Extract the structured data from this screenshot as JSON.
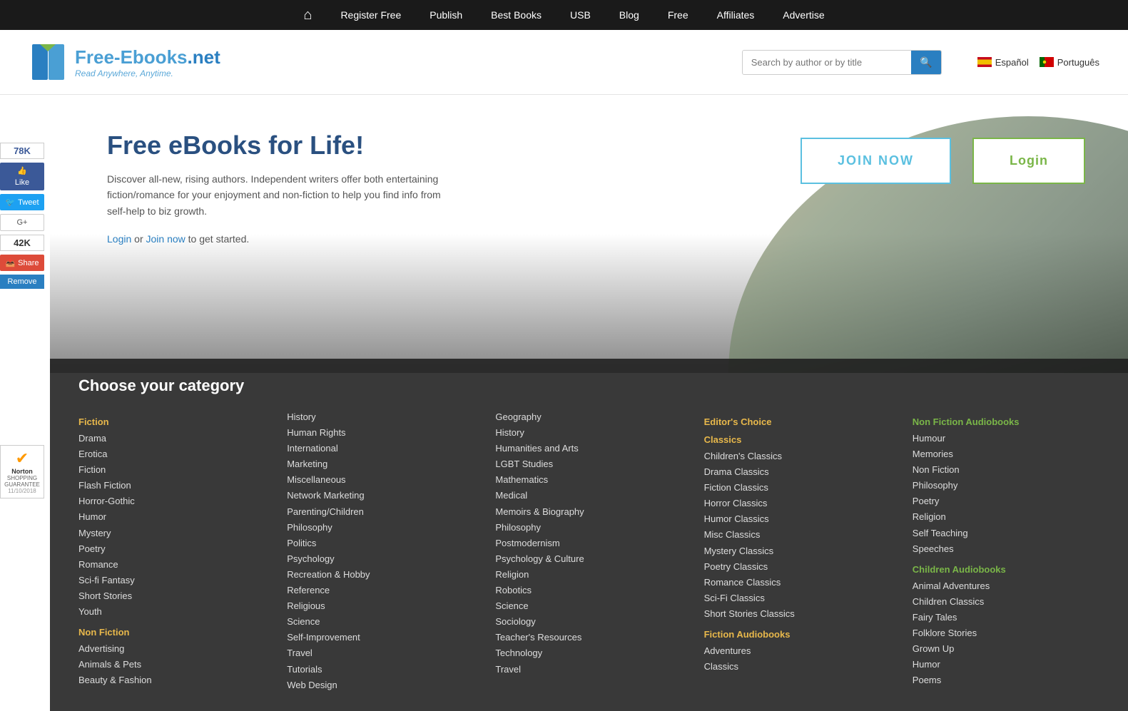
{
  "topnav": {
    "items": [
      {
        "label": "Register Free",
        "name": "register-free"
      },
      {
        "label": "Publish",
        "name": "publish"
      },
      {
        "label": "Best Books",
        "name": "best-books"
      },
      {
        "label": "USB",
        "name": "usb"
      },
      {
        "label": "Blog",
        "name": "blog"
      },
      {
        "label": "Free",
        "name": "free"
      },
      {
        "label": "Affiliates",
        "name": "affiliates"
      },
      {
        "label": "Advertise",
        "name": "advertise"
      }
    ]
  },
  "header": {
    "logo_name": "Free-Ebooks.net",
    "logo_tagline": "Read Anywhere, Anytime.",
    "search_placeholder": "Search by author or by title",
    "lang1": "Español",
    "lang2": "Português"
  },
  "social": {
    "fb_count": "78K",
    "fb_label": "Like",
    "tweet_label": "Tweet",
    "gplus_label": "G+",
    "share_count": "42K",
    "share_label": "Share",
    "remove_label": "Remove"
  },
  "hero": {
    "title": "Free eBooks for Life!",
    "description": "Discover all-new, rising authors. Independent writers offer both entertaining fiction/romance for your enjoyment and non-fiction to help you find info from self-help to biz growth.",
    "login_text": "Login",
    "or_text": "or",
    "join_text": "Join now",
    "get_started": "to get started.",
    "btn_join": "JOIN NOW",
    "btn_login": "Login"
  },
  "categories": {
    "title": "Choose your category",
    "cols": [
      {
        "sections": [
          {
            "heading": "Fiction",
            "heading_style": "gold",
            "items": [
              "Drama",
              "Erotica",
              "Fiction",
              "Flash Fiction",
              "Horror-Gothic",
              "Humor",
              "Mystery",
              "Poetry",
              "Romance",
              "Sci-fi Fantasy",
              "Short Stories",
              "Youth"
            ]
          },
          {
            "heading": "Non Fiction",
            "heading_style": "gold",
            "items": [
              "Advertising",
              "Animals & Pets",
              "Beauty & Fashion"
            ]
          }
        ]
      },
      {
        "sections": [
          {
            "heading": "",
            "heading_style": "",
            "items": [
              "History",
              "Human Rights",
              "International",
              "Marketing",
              "Miscellaneous",
              "Network Marketing",
              "Parenting/Children",
              "Philosophy",
              "Politics",
              "Psychology",
              "Recreation & Hobby",
              "Reference",
              "Religious",
              "Science",
              "Self-Improvement",
              "Travel",
              "Tutorials",
              "Web Design"
            ]
          }
        ]
      },
      {
        "sections": [
          {
            "heading": "",
            "heading_style": "",
            "items": [
              "Geography",
              "History",
              "Humanities and Arts",
              "LGBT Studies",
              "Mathematics",
              "Medical",
              "Memoirs & Biography",
              "Philosophy",
              "Postmodernism",
              "Psychology & Culture",
              "Religion",
              "Robotics",
              "Science",
              "Sociology",
              "Teacher's Resources",
              "Technology",
              "Travel"
            ]
          }
        ]
      },
      {
        "sections": [
          {
            "heading": "Editor's Choice",
            "heading_style": "gold",
            "items": []
          },
          {
            "heading": "Classics",
            "heading_style": "gold",
            "items": [
              "Children's Classics",
              "Drama Classics",
              "Fiction Classics",
              "Horror Classics",
              "Humor Classics",
              "Misc Classics",
              "Mystery Classics",
              "Poetry Classics",
              "Romance Classics",
              "Sci-Fi Classics",
              "Short Stories Classics"
            ]
          },
          {
            "heading": "Fiction Audiobooks",
            "heading_style": "gold",
            "items": [
              "Adventures",
              "Classics"
            ]
          }
        ]
      },
      {
        "sections": [
          {
            "heading": "Non Fiction Audiobooks",
            "heading_style": "green",
            "items": [
              "Humour",
              "Memories",
              "Non Fiction",
              "Philosophy",
              "Poetry",
              "Religion",
              "Self Teaching",
              "Speeches"
            ]
          },
          {
            "heading": "Children Audiobooks",
            "heading_style": "green",
            "items": [
              "Animal Adventures",
              "Children Classics",
              "Fairy Tales",
              "Folklore Stories",
              "Grown Up",
              "Humor",
              "Poems"
            ]
          }
        ]
      }
    ]
  }
}
